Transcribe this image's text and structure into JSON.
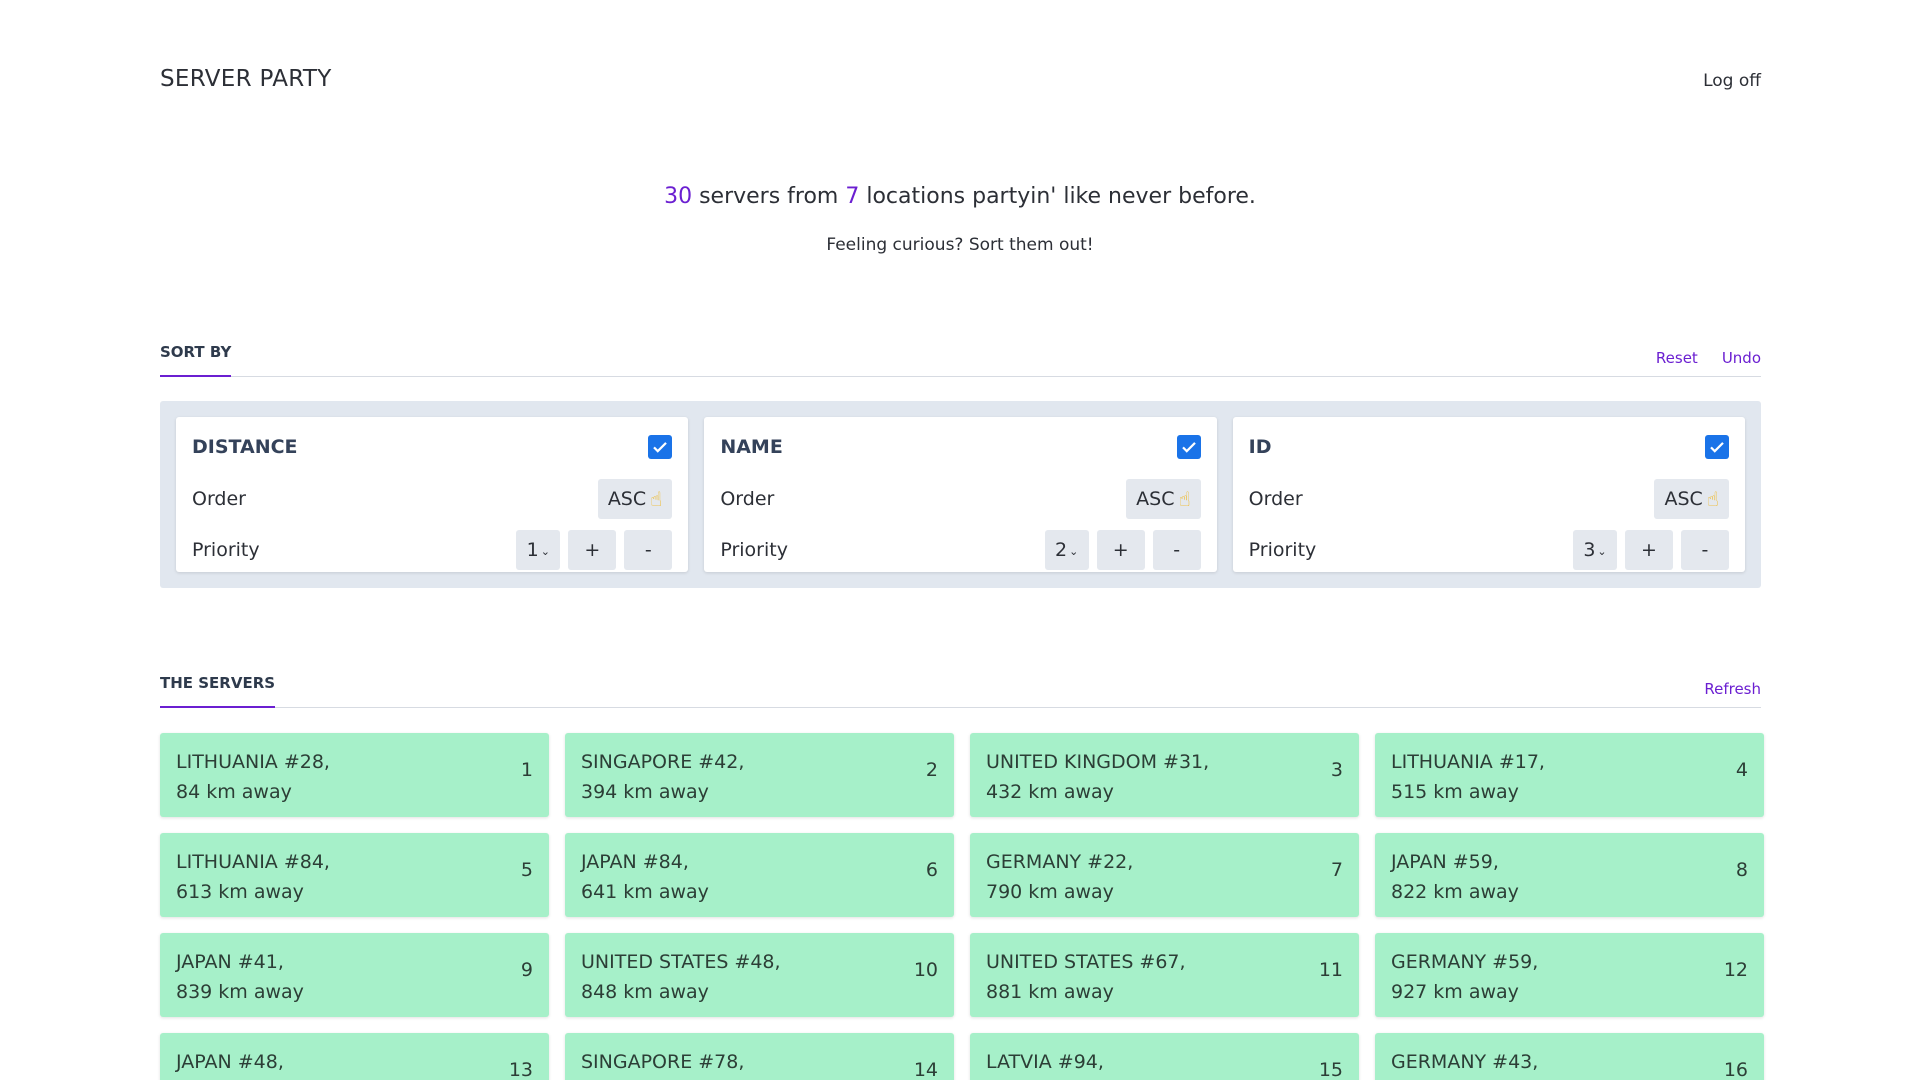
{
  "header": {
    "brand": "SERVER PARTY",
    "logoff": "Log off"
  },
  "hero": {
    "server_count": "30",
    "text_a": " servers from ",
    "location_count": "7",
    "text_b": " locations partyin' like never before.",
    "subtitle": "Feeling curious? Sort them out!"
  },
  "sort": {
    "title": "SORT BY",
    "reset": "Reset",
    "undo": "Undo",
    "order_label": "Order",
    "priority_label": "Priority",
    "cards": [
      {
        "title": "DISTANCE",
        "checked": true,
        "order": "ASC",
        "priority": "1"
      },
      {
        "title": "NAME",
        "checked": true,
        "order": "ASC",
        "priority": "2"
      },
      {
        "title": "ID",
        "checked": true,
        "order": "ASC",
        "priority": "3"
      }
    ],
    "plus": "+",
    "minus": "-"
  },
  "servers_section": {
    "title": "THE SERVERS",
    "refresh": "Refresh"
  },
  "servers": [
    {
      "name": "LITHUANIA #28,",
      "distance": "84 km away",
      "rank": "1"
    },
    {
      "name": "SINGAPORE #42,",
      "distance": "394 km away",
      "rank": "2"
    },
    {
      "name": "UNITED KINGDOM #31,",
      "distance": "432 km away",
      "rank": "3"
    },
    {
      "name": "LITHUANIA #17,",
      "distance": "515 km away",
      "rank": "4"
    },
    {
      "name": "LITHUANIA #84,",
      "distance": "613 km away",
      "rank": "5"
    },
    {
      "name": "JAPAN #84,",
      "distance": "641 km away",
      "rank": "6"
    },
    {
      "name": "GERMANY #22,",
      "distance": "790 km away",
      "rank": "7"
    },
    {
      "name": "JAPAN #59,",
      "distance": "822 km away",
      "rank": "8"
    },
    {
      "name": "JAPAN #41,",
      "distance": "839 km away",
      "rank": "9"
    },
    {
      "name": "UNITED STATES #48,",
      "distance": "848 km away",
      "rank": "10"
    },
    {
      "name": "UNITED STATES #67,",
      "distance": "881 km away",
      "rank": "11"
    },
    {
      "name": "GERMANY #59,",
      "distance": "927 km away",
      "rank": "12"
    },
    {
      "name": "JAPAN #48,",
      "distance": "",
      "rank": "13"
    },
    {
      "name": "SINGAPORE #78,",
      "distance": "",
      "rank": "14"
    },
    {
      "name": "LATVIA #94,",
      "distance": "",
      "rank": "15"
    },
    {
      "name": "GERMANY #43,",
      "distance": "",
      "rank": "16"
    }
  ],
  "colors": {
    "accent": "#6b1fd1",
    "server_card": "#a6f0c9",
    "panel": "#e1e7ef",
    "checkbox": "#1a73e8"
  },
  "icons": {
    "order_toggle": "pointing-hand-icon",
    "checkbox": "check-icon",
    "priority_dropdown": "chevron-down-icon"
  }
}
